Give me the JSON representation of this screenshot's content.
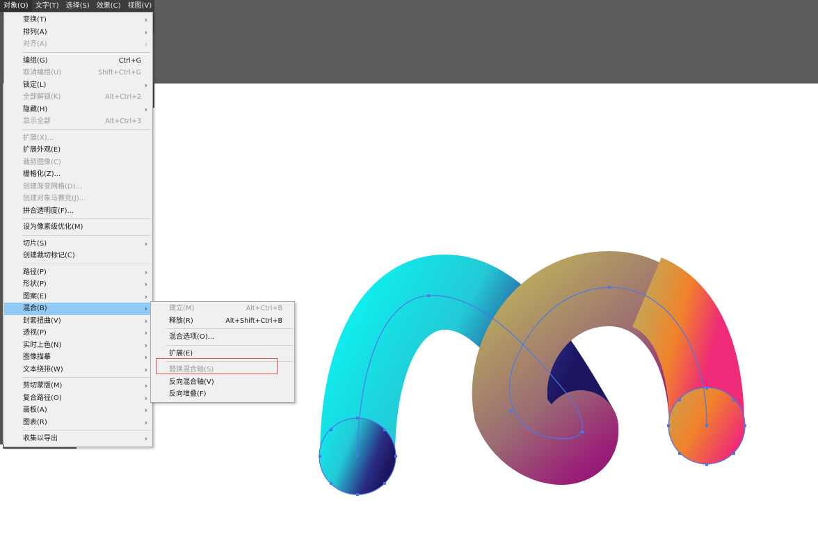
{
  "menubar": [
    "对象(O)",
    "文字(T)",
    "选择(S)",
    "效果(C)",
    "视图(V)"
  ],
  "object_menu": [
    {
      "label": "变换(T)",
      "sub": true
    },
    {
      "label": "排列(A)",
      "sub": true
    },
    {
      "label": "对齐(A)",
      "sub": true,
      "disabled": true
    },
    {
      "sep": true
    },
    {
      "label": "编组(G)",
      "shortcut": "Ctrl+G"
    },
    {
      "label": "取消编组(U)",
      "shortcut": "Shift+Ctrl+G",
      "disabled": true
    },
    {
      "label": "锁定(L)",
      "sub": true
    },
    {
      "label": "全部解锁(K)",
      "shortcut": "Alt+Ctrl+2",
      "disabled": true
    },
    {
      "label": "隐藏(H)",
      "sub": true
    },
    {
      "label": "显示全部",
      "shortcut": "Alt+Ctrl+3",
      "disabled": true
    },
    {
      "sep": true
    },
    {
      "label": "扩展(X)...",
      "disabled": true
    },
    {
      "label": "扩展外观(E)"
    },
    {
      "label": "裁剪图像(C)",
      "disabled": true
    },
    {
      "label": "栅格化(Z)..."
    },
    {
      "label": "创建渐变网格(D)...",
      "disabled": true
    },
    {
      "label": "创建对象马赛克(J)...",
      "disabled": true
    },
    {
      "label": "拼合透明度(F)..."
    },
    {
      "sep": true
    },
    {
      "label": "设为像素级优化(M)"
    },
    {
      "sep": true
    },
    {
      "label": "切片(S)",
      "sub": true
    },
    {
      "label": "创建裁切标记(C)"
    },
    {
      "sep": true
    },
    {
      "label": "路径(P)",
      "sub": true
    },
    {
      "label": "形状(P)",
      "sub": true
    },
    {
      "label": "图案(E)",
      "sub": true
    },
    {
      "label": "混合(B)",
      "sub": true,
      "highlight": true
    },
    {
      "label": "封套扭曲(V)",
      "sub": true
    },
    {
      "label": "透视(P)",
      "sub": true
    },
    {
      "label": "实时上色(N)",
      "sub": true
    },
    {
      "label": "图像描摹",
      "sub": true
    },
    {
      "label": "文本绕排(W)",
      "sub": true
    },
    {
      "sep": true
    },
    {
      "label": "剪切蒙版(M)",
      "sub": true
    },
    {
      "label": "复合路径(O)",
      "sub": true
    },
    {
      "label": "画板(A)",
      "sub": true
    },
    {
      "label": "图表(R)",
      "sub": true
    },
    {
      "sep": true
    },
    {
      "label": "收集以导出",
      "sub": true
    }
  ],
  "blend_submenu": [
    {
      "label": "建立(M)",
      "shortcut": "Alt+Ctrl+B",
      "disabled": true
    },
    {
      "label": "释放(R)",
      "shortcut": "Alt+Shift+Ctrl+B"
    },
    {
      "sep": true
    },
    {
      "label": "混合选项(O)..."
    },
    {
      "sep": true
    },
    {
      "label": "扩展(E)"
    },
    {
      "sep": true
    },
    {
      "label": "替换混合轴(S)",
      "disabled": true
    },
    {
      "label": "反向混合轴(V)"
    },
    {
      "label": "反向堆叠(F)"
    }
  ],
  "arrow_glyph": "›",
  "colors": {
    "highlight": "#91c9f7",
    "selection": "#4a78e8",
    "red_box": "#e05050"
  }
}
